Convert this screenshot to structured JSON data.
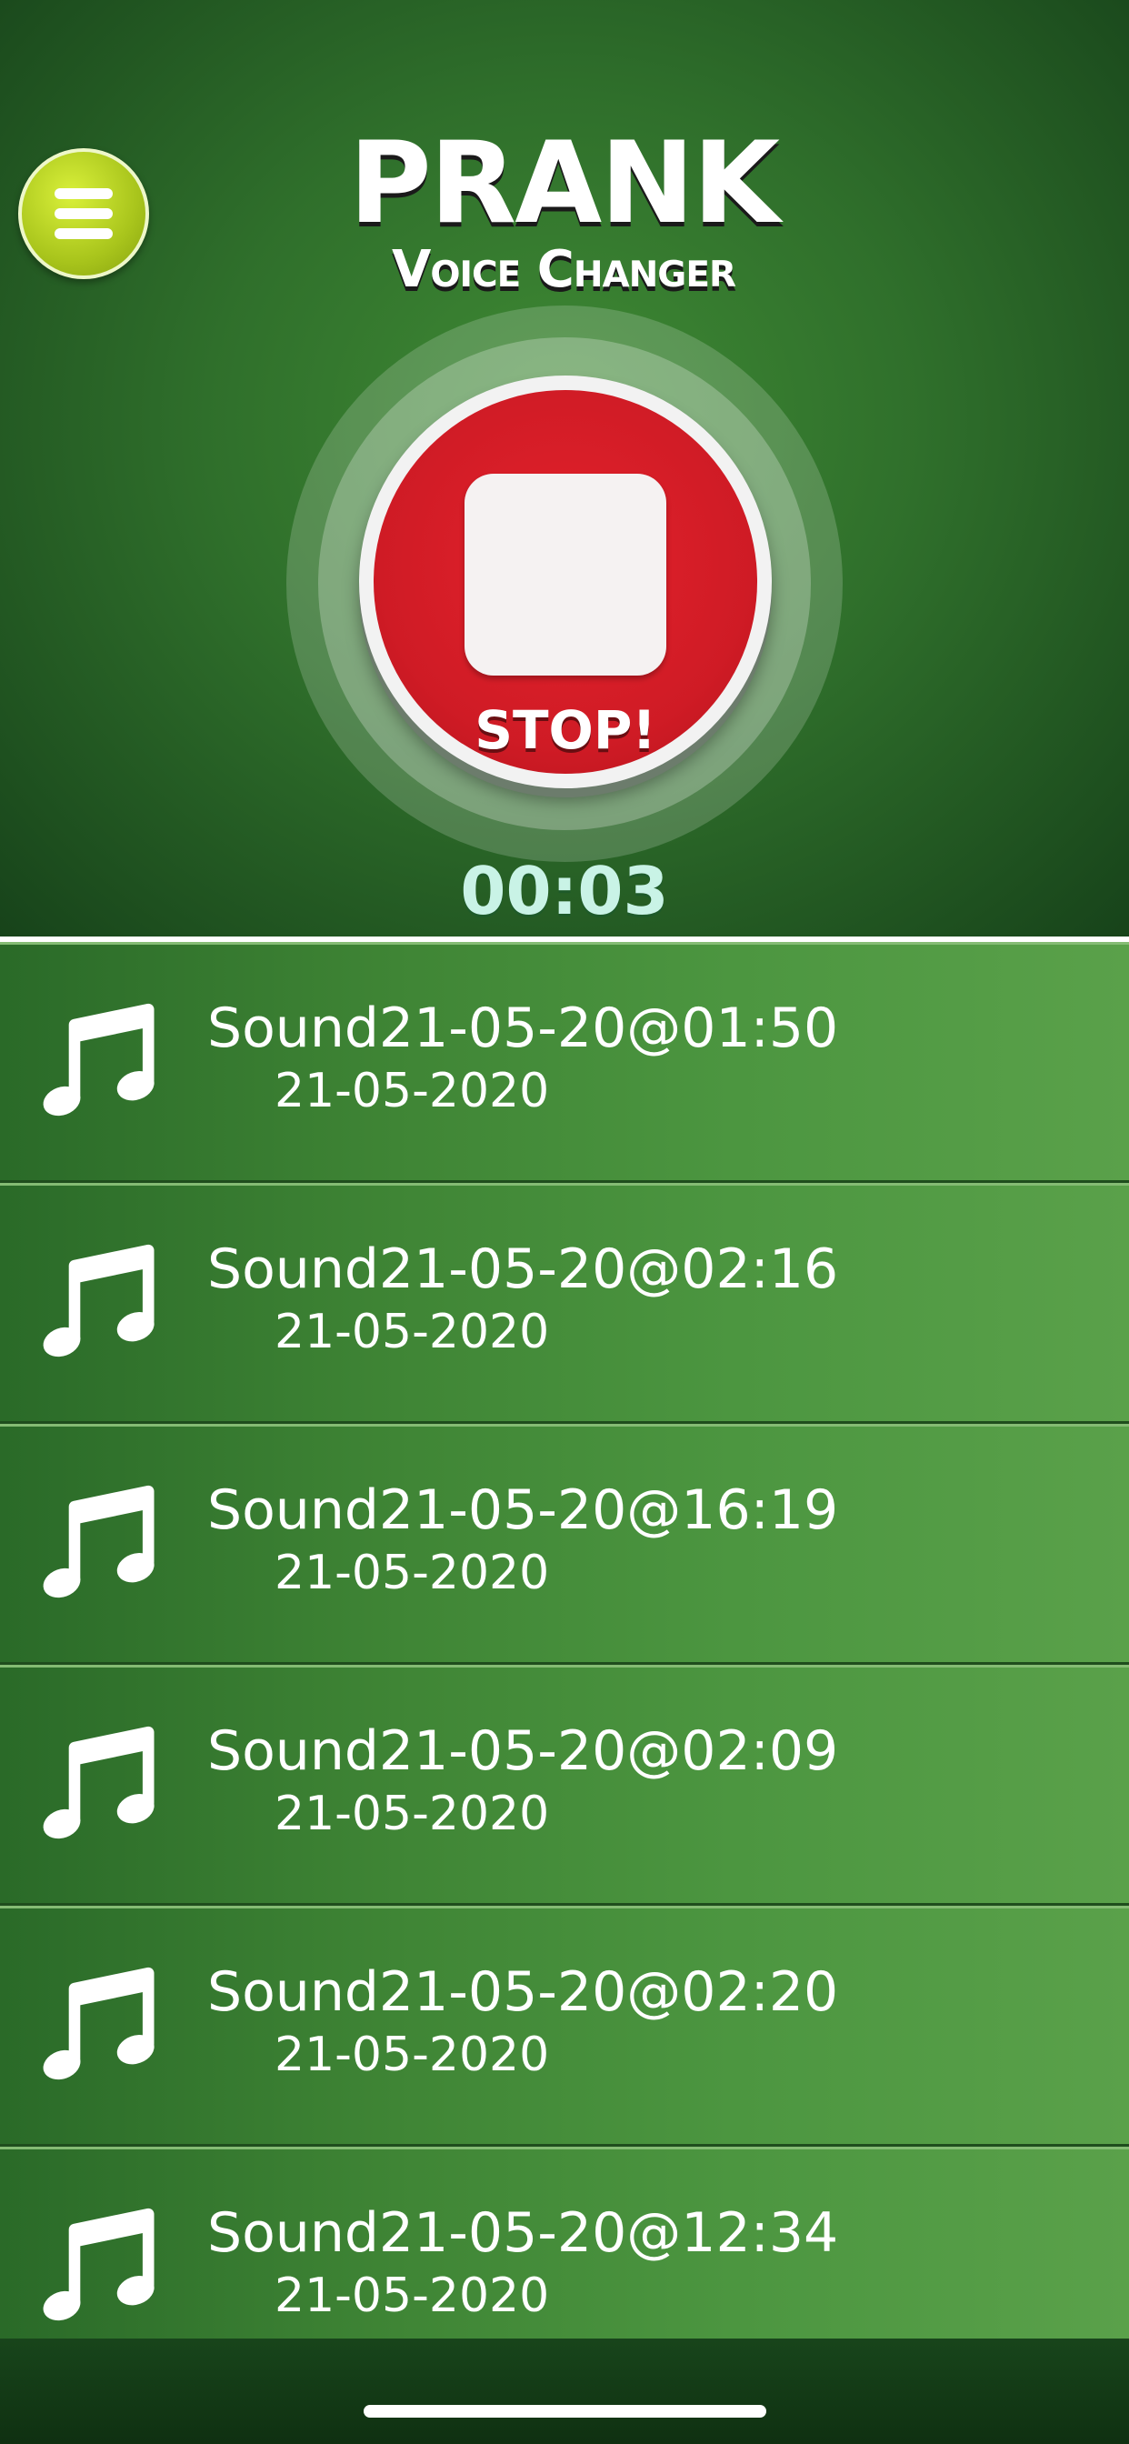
{
  "header": {
    "title_line1": "PRANK",
    "title_line2": "Voice Changer",
    "menu_icon": "hamburger-menu-icon"
  },
  "recorder": {
    "button_label": "STOP!",
    "button_icon": "stop-square-icon",
    "timer": "00:03"
  },
  "recordings": [
    {
      "title": "Sound21-05-20@01:50",
      "date": "21-05-2020",
      "icon": "music-note-icon"
    },
    {
      "title": "Sound21-05-20@02:16",
      "date": "21-05-2020",
      "icon": "music-note-icon"
    },
    {
      "title": "Sound21-05-20@16:19",
      "date": "21-05-2020",
      "icon": "music-note-icon"
    },
    {
      "title": "Sound21-05-20@02:09",
      "date": "21-05-2020",
      "icon": "music-note-icon"
    },
    {
      "title": "Sound21-05-20@02:20",
      "date": "21-05-2020",
      "icon": "music-note-icon"
    },
    {
      "title": "Sound21-05-20@12:34",
      "date": "21-05-2020",
      "icon": "music-note-icon"
    }
  ],
  "colors": {
    "background_green": "#2f6f2b",
    "menu_button": "#a9c51c",
    "stop_button_red": "#cf1b25",
    "timer_text": "#c9f3e6"
  }
}
